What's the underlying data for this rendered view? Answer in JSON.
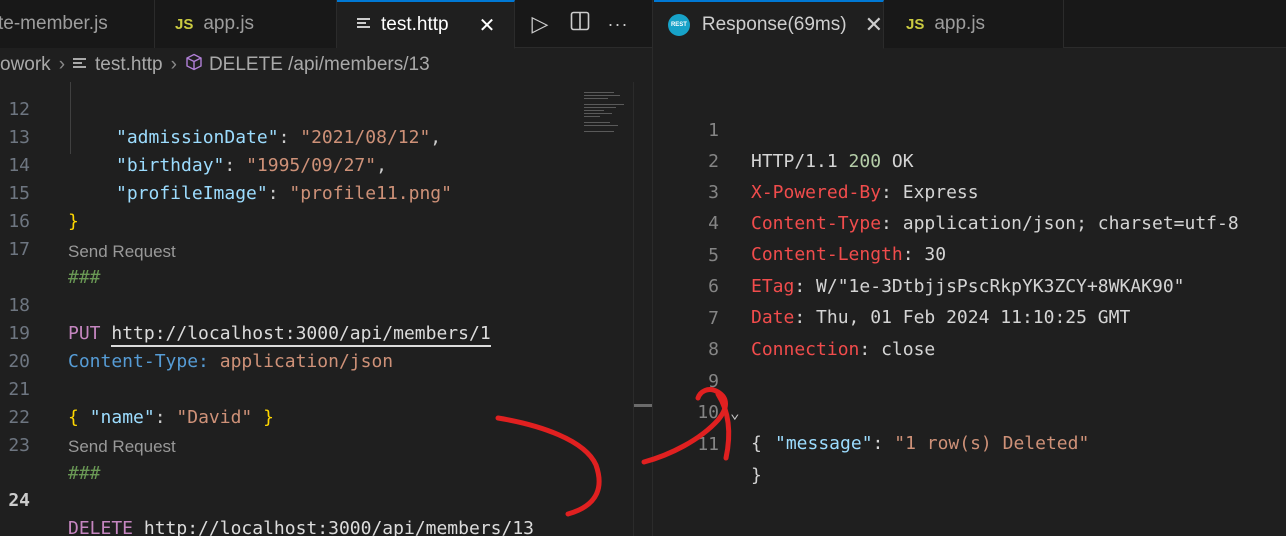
{
  "left_tabs": [
    {
      "label": "te-member.js",
      "icon": "",
      "active": false
    },
    {
      "label": "app.js",
      "icon": "JS",
      "active": false
    },
    {
      "label": "test.http",
      "icon": "file-lines-icon",
      "active": true,
      "close": "✕"
    }
  ],
  "actions": {
    "run": "▷",
    "split": "◫",
    "more": "···"
  },
  "breadcrumb": {
    "folder": "owork",
    "file": "test.http",
    "symbol": "DELETE /api/members/13"
  },
  "editor": {
    "lines": [
      {
        "n": "12",
        "parts": []
      },
      {
        "n": "13",
        "key": "\"birthday\"",
        "value": "\"1995/09/27\"",
        "tail": ","
      },
      {
        "n": "14",
        "key": "\"profileImage\"",
        "value": "\"profile11.png\"",
        "tail": ""
      },
      {
        "n": "15",
        "brace": "}"
      },
      {
        "n": "16"
      },
      {
        "n": "17",
        "comment": "###"
      },
      {
        "n": "18",
        "method": "PUT",
        "url": "http://localhost:3000/api/members/1"
      },
      {
        "n": "19",
        "hdr_name": "Content-Type:",
        "hdr_val": "application/json"
      },
      {
        "n": "20"
      },
      {
        "n": "21",
        "open": "{",
        "key": "\"name\"",
        "value": "\"David\"",
        "close": "}"
      },
      {
        "n": "22"
      },
      {
        "n": "23",
        "comment": "###"
      },
      {
        "n": "24",
        "method": "DELETE",
        "url": "http://localhost:3000/api/members/13"
      }
    ],
    "line12_key": "\"admissionDate\"",
    "line12_value": "\"2021/08/12\"",
    "line12_tail": ",",
    "codelens": "Send Request"
  },
  "right_tabs": [
    {
      "label": "Response(69ms)",
      "active": true,
      "close": "✕"
    },
    {
      "label": "app.js",
      "icon": "JS",
      "active": false
    }
  ],
  "response": {
    "status_proto": "HTTP/1.1",
    "status_code": "200",
    "status_text": "OK",
    "headers": [
      {
        "n": "2",
        "name": "X-Powered-By",
        "value": "Express"
      },
      {
        "n": "3",
        "name": "Content-Type",
        "value": "application/json; charset=utf-8"
      },
      {
        "n": "4",
        "name": "Content-Length",
        "value": "30"
      },
      {
        "n": "5",
        "name": "ETag",
        "value": "W/\"1e-3DtbjjsPscRkpYK3ZCY+8WKAK90\""
      },
      {
        "n": "6",
        "name": "Date",
        "value": "Thu, 01 Feb 2024 11:10:25 GMT"
      },
      {
        "n": "7",
        "name": "Connection",
        "value": "close"
      }
    ],
    "line_numbers": [
      "1",
      "8",
      "9",
      "10",
      "11"
    ],
    "body_open": "{",
    "body_key": "\"message\"",
    "body_value": "\"1 row(s) Deleted\"",
    "body_close": "}",
    "fold_icon": "chevron-down-icon"
  },
  "colors": {
    "accent": "#0078d4",
    "annotation": "#e02020"
  }
}
